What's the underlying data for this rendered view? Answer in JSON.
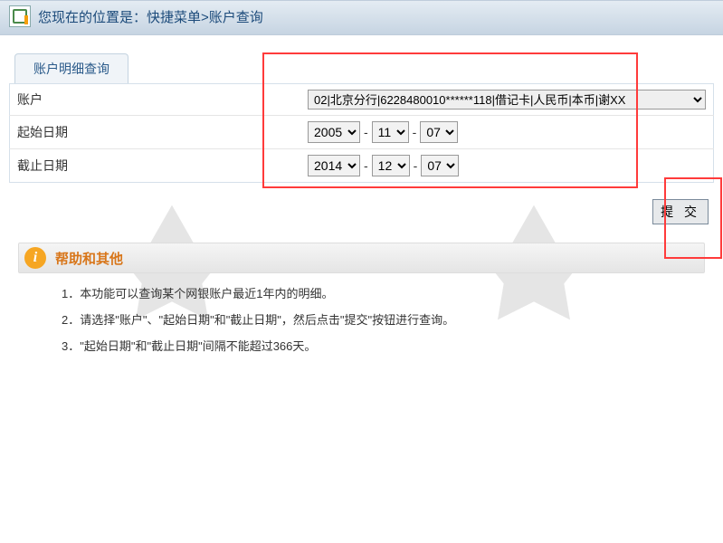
{
  "breadcrumb": "您现在的位置是：快捷菜单>账户查询",
  "tab": {
    "label": "账户明细查询"
  },
  "form": {
    "account_label": "账户",
    "account_value": "02|北京分行|6228480010******118|借记卡|人民币|本币|谢XX",
    "start_date_label": "起始日期",
    "start_date": {
      "year": "2005",
      "month": "11",
      "day": "07"
    },
    "end_date_label": "截止日期",
    "end_date": {
      "year": "2014",
      "month": "12",
      "day": "07"
    }
  },
  "submit_label": "提 交",
  "help": {
    "title": "帮助和其他",
    "items": [
      "1．本功能可以查询某个网银账户最近1年内的明细。",
      "2．请选择\"账户\"、\"起始日期\"和\"截止日期\"，然后点击\"提交\"按钮进行查询。",
      "3．\"起始日期\"和\"截止日期\"间隔不能超过366天。"
    ]
  }
}
